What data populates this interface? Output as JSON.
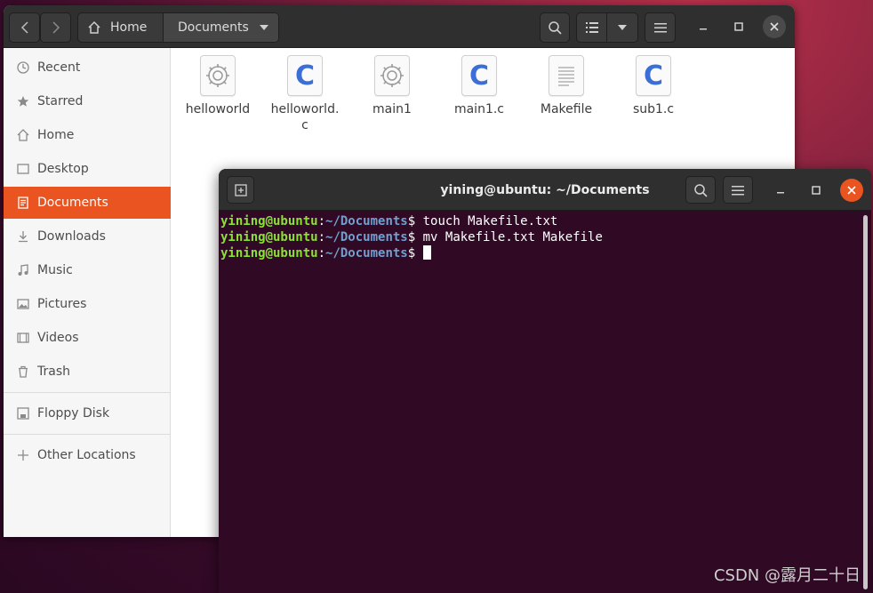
{
  "file_manager": {
    "breadcrumb": {
      "home": "Home",
      "current": "Documents"
    },
    "sidebar": [
      {
        "label": "Recent",
        "icon": "clock-icon"
      },
      {
        "label": "Starred",
        "icon": "star-icon"
      },
      {
        "label": "Home",
        "icon": "home-icon"
      },
      {
        "label": "Desktop",
        "icon": "desktop-icon"
      },
      {
        "label": "Documents",
        "icon": "document-icon",
        "active": true
      },
      {
        "label": "Downloads",
        "icon": "download-icon"
      },
      {
        "label": "Music",
        "icon": "music-icon"
      },
      {
        "label": "Pictures",
        "icon": "picture-icon"
      },
      {
        "label": "Videos",
        "icon": "video-icon"
      },
      {
        "label": "Trash",
        "icon": "trash-icon"
      },
      {
        "label": "Floppy Disk",
        "icon": "floppy-icon"
      },
      {
        "label": "Other Locations",
        "icon": "plus-icon"
      }
    ],
    "files": [
      {
        "name": "helloworld",
        "type": "executable"
      },
      {
        "name": "helloworld.\nc",
        "type": "c-source"
      },
      {
        "name": "main1",
        "type": "executable"
      },
      {
        "name": "main1.c",
        "type": "c-source"
      },
      {
        "name": "Makefile",
        "type": "text"
      },
      {
        "name": "sub1.c",
        "type": "c-source"
      }
    ],
    "c_letter": "C"
  },
  "terminal": {
    "title": "yining@ubuntu: ~/Documents",
    "prompt_user": "yining@ubuntu",
    "prompt_sep": ":",
    "prompt_path": "~/Documents",
    "prompt_char": "$",
    "lines": [
      {
        "command": " touch Makefile.txt"
      },
      {
        "command": " mv Makefile.txt Makefile"
      },
      {
        "command": " "
      }
    ]
  },
  "watermark": "CSDN @露月二十日",
  "colors": {
    "accent": "#e95420",
    "terminal_bg": "#300a24",
    "prompt_user": "#8ae234",
    "prompt_path": "#729fcf"
  }
}
